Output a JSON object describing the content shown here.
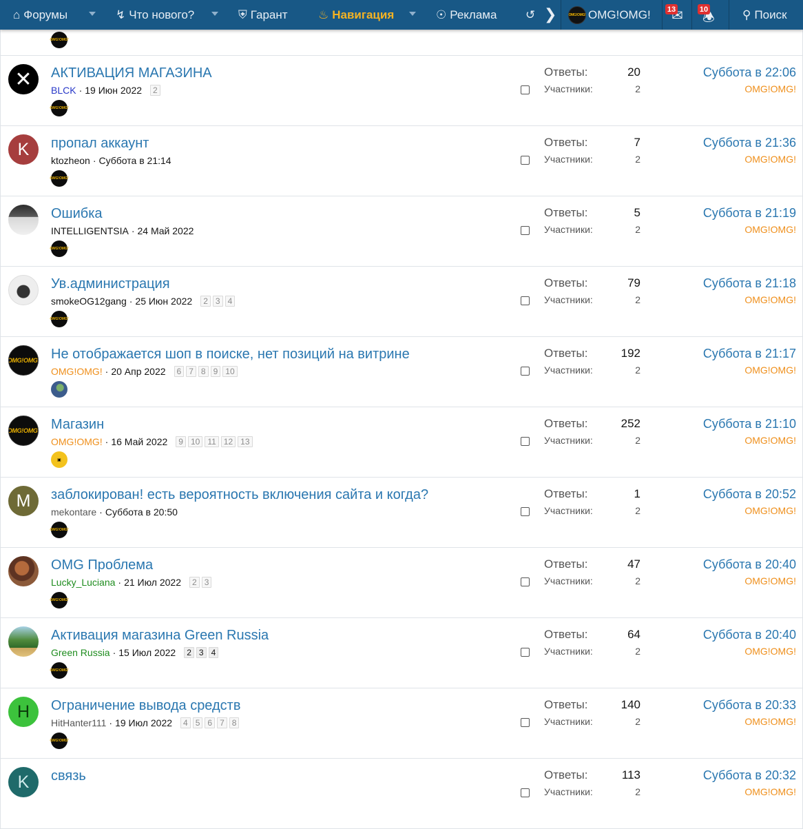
{
  "nav": {
    "forums": "Форумы",
    "whats_new": "Что нового?",
    "guarantor": "Гарант",
    "navigation": "Навигация",
    "ads": "Реклама",
    "username": "OMG!OMG!",
    "inbox_count": "13",
    "alerts_count": "10",
    "search": "Поиск",
    "accent": "#f5b323",
    "bar_color": "#185886"
  },
  "labels": {
    "replies": "Ответы:",
    "participants": "Участники:"
  },
  "threads": [
    {
      "title": "АКТИВАЦИЯ МАГАЗИНА",
      "author": "BLCK",
      "date": "19 Июн 2022",
      "pages": [
        "2"
      ],
      "replies": "20",
      "participants": "2",
      "last_date": "Суббота в 22:06",
      "last_user": "OMG!OMG!"
    },
    {
      "title": "пропал аккаунт",
      "author": "ktozheon",
      "avatar_letter": "K",
      "date": "Суббота в 21:14",
      "pages": [],
      "replies": "7",
      "participants": "2",
      "last_date": "Суббота в 21:36",
      "last_user": "OMG!OMG!"
    },
    {
      "title": "Ошибка",
      "author": "INTELLIGENTSIA",
      "date": "24 Май 2022",
      "pages": [],
      "replies": "5",
      "participants": "2",
      "last_date": "Суббота в 21:19",
      "last_user": "OMG!OMG!"
    },
    {
      "title": "Ув.администрация",
      "author": "smokeOG12gang",
      "date": "25 Июн 2022",
      "pages": [
        "2",
        "3",
        "4"
      ],
      "replies": "79",
      "participants": "2",
      "last_date": "Суббота в 21:18",
      "last_user": "OMG!OMG!"
    },
    {
      "title": "Не отображается шоп в поиске, нет позиций на витрине",
      "author": "OMG!OMG!",
      "date": "20 Апр 2022",
      "pages": [
        "6",
        "7",
        "8",
        "9",
        "10"
      ],
      "replies": "192",
      "participants": "2",
      "last_date": "Суббота в 21:17",
      "last_user": "OMG!OMG!"
    },
    {
      "title": "Магазин",
      "author": "OMG!OMG!",
      "date": "16 Май 2022",
      "pages": [
        "9",
        "10",
        "11",
        "12",
        "13"
      ],
      "replies": "252",
      "participants": "2",
      "last_date": "Суббота в 21:10",
      "last_user": "OMG!OMG!"
    },
    {
      "title": "заблокирован! есть вероятность включения сайта и когда?",
      "author": "mekontare",
      "avatar_letter": "M",
      "date": "Суббота в 20:50",
      "pages": [],
      "replies": "1",
      "participants": "2",
      "last_date": "Суббота в 20:52",
      "last_user": "OMG!OMG!"
    },
    {
      "title": "OMG Проблема",
      "author": "Lucky_Luciana",
      "date": "21 Июл 2022",
      "pages": [
        "2",
        "3"
      ],
      "replies": "47",
      "participants": "2",
      "last_date": "Суббота в 20:40",
      "last_user": "OMG!OMG!"
    },
    {
      "title": "Активация магазина Green Russia",
      "author": "Green Russia",
      "date": "15 Июл 2022",
      "pages": [
        "2",
        "3",
        "4"
      ],
      "replies": "64",
      "participants": "2",
      "last_date": "Суббота в 20:40",
      "last_user": "OMG!OMG!"
    },
    {
      "title": "Ограничение вывода средств",
      "author": "HitHanter111",
      "avatar_letter": "H",
      "date": "19 Июл 2022",
      "pages": [
        "4",
        "5",
        "6",
        "7",
        "8"
      ],
      "replies": "140",
      "participants": "2",
      "last_date": "Суббота в 20:33",
      "last_user": "OMG!OMG!"
    },
    {
      "title": "связь",
      "author": "",
      "avatar_letter": "K",
      "date": "",
      "pages": [],
      "replies": "113",
      "participants": "2",
      "last_date": "Суббота в 20:32",
      "last_user": "OMG!OMG!"
    }
  ],
  "mini_avatar_text": "OMG!OMG!"
}
